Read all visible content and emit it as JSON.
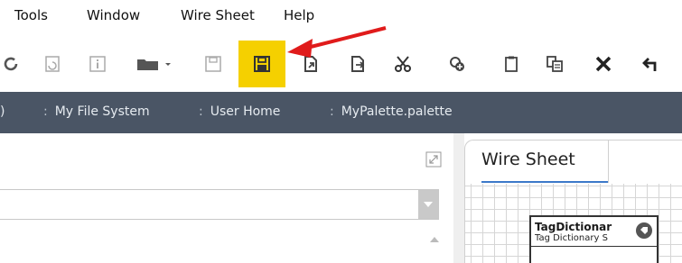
{
  "menubar": {
    "items": [
      "Tools",
      "Window",
      "Wire Sheet",
      "Help"
    ]
  },
  "toolbar": {
    "buttons": [
      {
        "icon": "refresh-icon"
      },
      {
        "icon": "history-icon"
      },
      {
        "icon": "info-icon"
      },
      {
        "icon": "folder-open-icon"
      },
      {
        "icon": "save-icon"
      },
      {
        "icon": "save-all-icon",
        "highlighted": true
      },
      {
        "icon": "export-icon"
      },
      {
        "icon": "import-icon"
      },
      {
        "icon": "cut-icon"
      },
      {
        "icon": "add-icon"
      },
      {
        "icon": "clipboard-icon"
      },
      {
        "icon": "duplicate-icon"
      },
      {
        "icon": "delete-icon"
      },
      {
        "icon": "undo-icon"
      }
    ],
    "highlight_color": "#f5d000"
  },
  "breadcrumb": {
    "leading": ")",
    "items": [
      "My File System",
      "User Home",
      "MyPalette.palette"
    ],
    "separator": ":"
  },
  "wiresheet": {
    "tab_label": "Wire Sheet",
    "node": {
      "title": "TagDictionar",
      "subtitle": "Tag Dictionary S"
    }
  },
  "annotation": {
    "arrow_color": "#e01b1b"
  }
}
